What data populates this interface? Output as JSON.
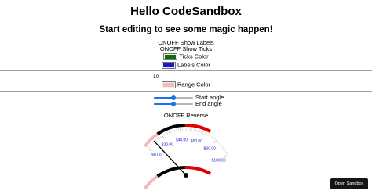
{
  "header": {
    "title": "Hello CodeSandbox",
    "subtitle": "Start editing to see some magic happen!"
  },
  "toggles": {
    "labels": {
      "on": "ON",
      "off": "OFF",
      "text": "Show Labels"
    },
    "ticks": {
      "on": "ON",
      "off": "OFF",
      "text": "Show Ticks"
    },
    "reverse": {
      "on": "ON",
      "off": "OFF",
      "text": "Reverse"
    }
  },
  "colors": {
    "ticks": {
      "label": "Ticks Color",
      "value": "#0b6e0b"
    },
    "labels": {
      "label": "Labels Color",
      "value": "#1a1acc"
    },
    "range": {
      "label": "Range Color",
      "value": "#f4b9b9"
    }
  },
  "value_input": {
    "value": "10"
  },
  "sliders": {
    "start_angle": {
      "label": "Start angle",
      "fraction": 0.5
    },
    "end_angle": {
      "label": "End angle",
      "fraction": 0.5
    }
  },
  "gauge": {
    "min": 0,
    "max": 100,
    "value": 10,
    "tick_labels": [
      "$0.00",
      "$20.00",
      "$40.00",
      "$60.00",
      "$80.00",
      "$100.00"
    ],
    "label_color": "#2222dd",
    "tick_color": "#bbbbbb",
    "needle_color": "#000000",
    "ranges": [
      {
        "from": 0,
        "to": 17,
        "color": "#f4b9b9"
      },
      {
        "from": 17,
        "to": 45,
        "color": "#000000"
      },
      {
        "from": 45,
        "to": 70,
        "color": "#e00000"
      }
    ]
  },
  "footer": {
    "open_sandbox": "Open Sandbox"
  }
}
